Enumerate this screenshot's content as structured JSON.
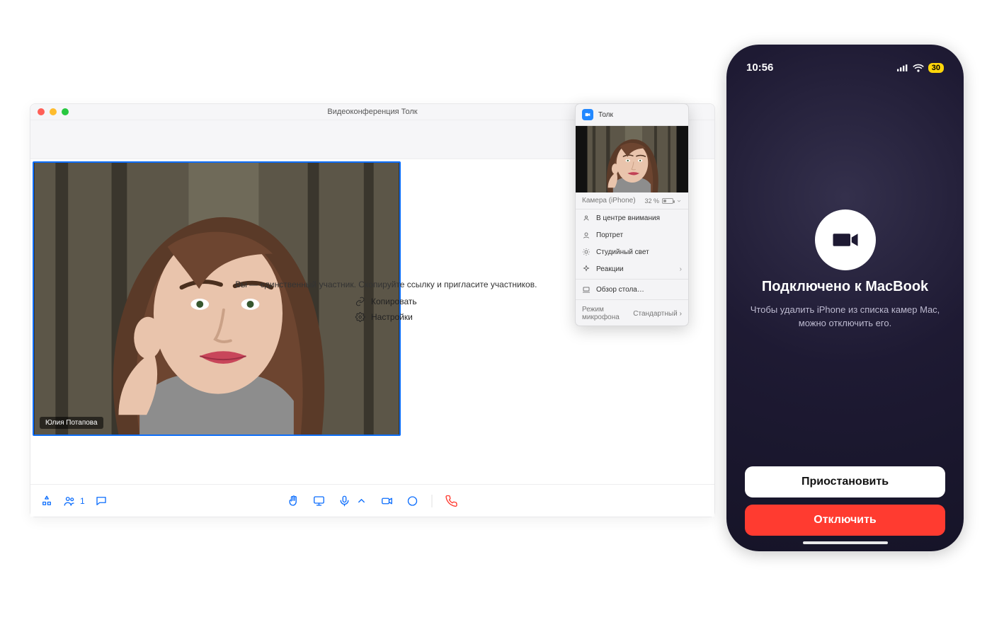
{
  "desktop": {
    "window_title": "Видеоконференция Толк",
    "participant_name": "Юлия Потапова",
    "solo_prompt": "Вы — единственный участник. Скопируйте ссылку и пригласите участников.",
    "actions": {
      "copy": "Копировать",
      "settings": "Настройки"
    },
    "participants_count": "1"
  },
  "popover": {
    "app_name": "Толк",
    "device_label": "Камера (iPhone)",
    "battery_pct": "32 %",
    "items": {
      "center_stage": "В центре внимания",
      "portrait": "Портрет",
      "studio_light": "Студийный свет",
      "reactions": "Реакции",
      "desk_view": "Обзор стола…"
    },
    "mic_mode_label": "Режим микрофона",
    "mic_mode_value": "Стандартный"
  },
  "phone": {
    "time": "10:56",
    "battery": "30",
    "title": "Подключено к MacBook",
    "subtitle": "Чтобы удалить iPhone из списка камер Mac, можно отключить его.",
    "pause_btn": "Приостановить",
    "disconnect_btn": "Отключить"
  }
}
